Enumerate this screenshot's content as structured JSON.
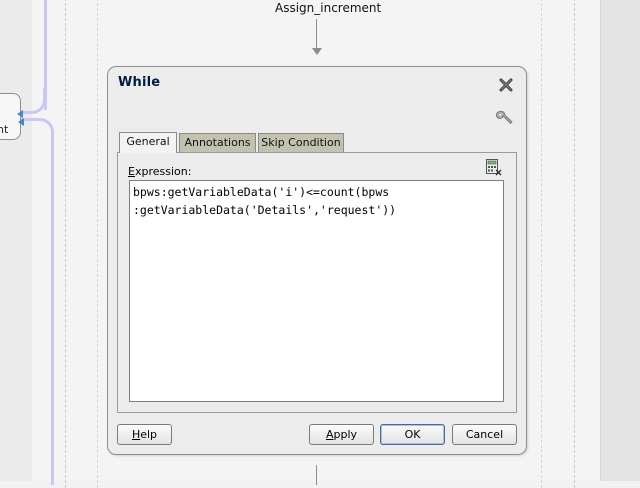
{
  "canvas": {
    "assign_activity_label": "Assign_increment",
    "partial_activity_label": "nt"
  },
  "dialog": {
    "title": "While",
    "tabs": [
      {
        "label": "General",
        "active": true
      },
      {
        "label": "Annotations",
        "active": false
      },
      {
        "label": "Skip Condition",
        "active": false
      }
    ],
    "expression_label": "Expression:",
    "expression_lines": [
      "bpws:getVariableData('i')<=count(bpws",
      ":getVariableData('Details','request'))"
    ],
    "buttons": {
      "help": "Help",
      "apply": "Apply",
      "ok": "OK",
      "cancel": "Cancel"
    },
    "icons": {
      "close": "close-icon",
      "settings": "wrench-icon",
      "expression_builder": "expression-builder-icon"
    }
  },
  "colors": {
    "tab_inactive": "#c3c1b0",
    "link_line": "#c8c8f2",
    "port": "#3e8ad0"
  }
}
